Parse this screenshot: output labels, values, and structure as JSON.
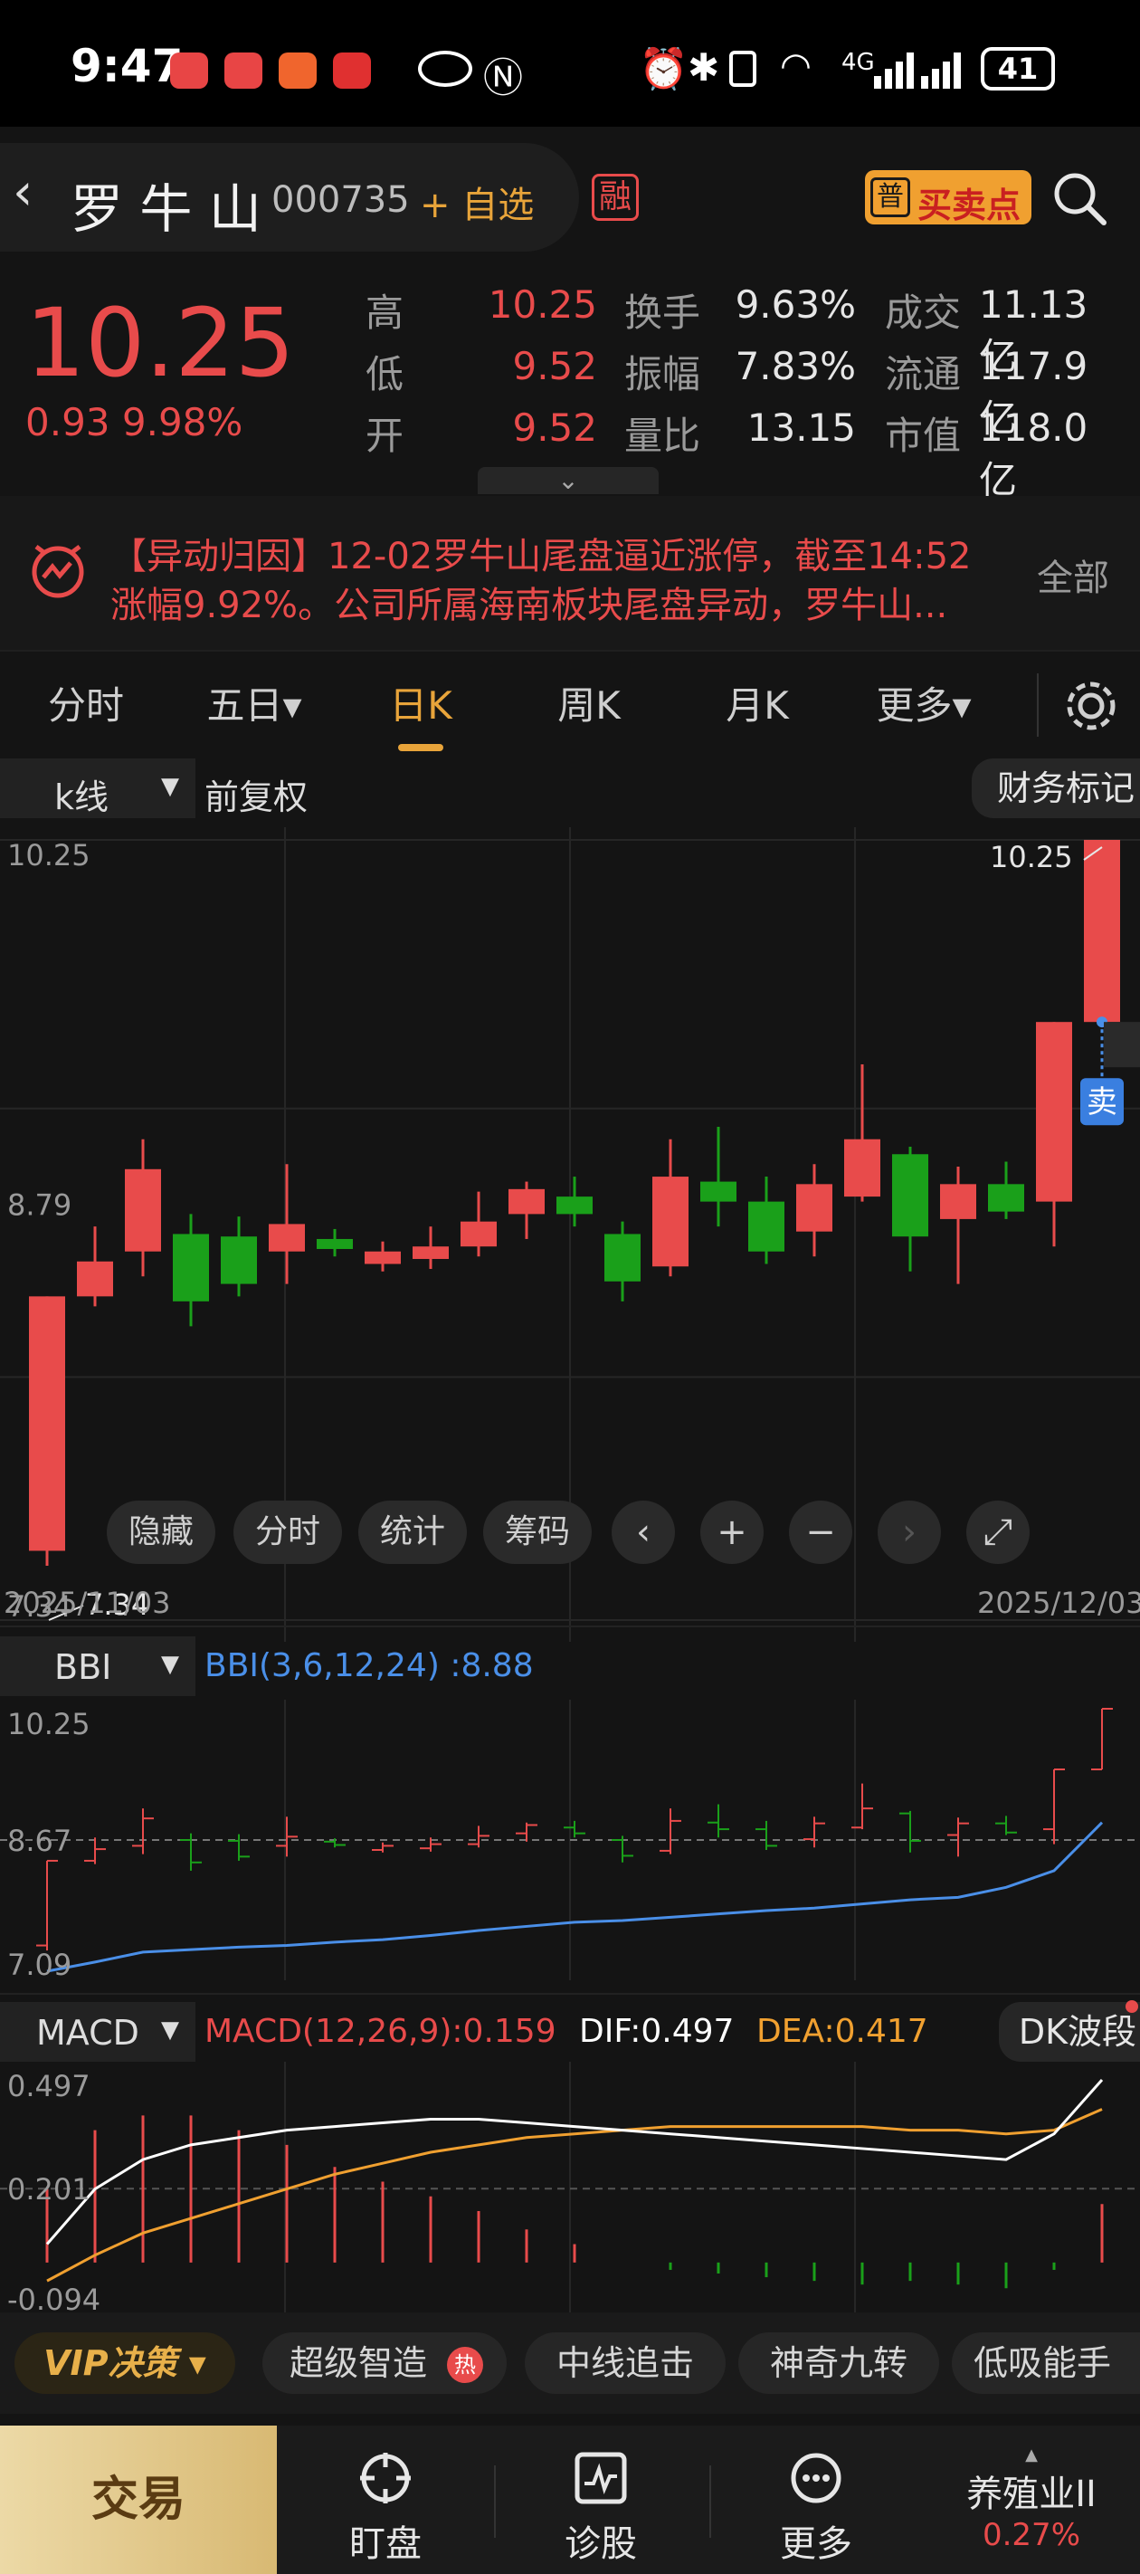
{
  "status_bar": {
    "time": "9:47",
    "battery": "41",
    "network": "4G",
    "app_badges": [
      "huawei-app-icon",
      "red-app-icon",
      "orange-app-icon",
      "red-app-icon-2"
    ]
  },
  "header": {
    "stock_name": "罗 牛 山",
    "stock_code": "000735",
    "add_watch": "+ 自选",
    "margin_tag": "融",
    "buy_sell_label": "买卖点",
    "buy_sell_badge": "普"
  },
  "quote": {
    "price": "10.25",
    "change": "0.93 9.98%",
    "rows": [
      {
        "l1": "高",
        "v1": "10.25",
        "l2": "换手",
        "v2": "9.63%",
        "l3": "成交",
        "v3": "11.13亿"
      },
      {
        "l1": "低",
        "v1": "9.52",
        "l2": "振幅",
        "v2": "7.83%",
        "l3": "流通",
        "v3": "117.9亿"
      },
      {
        "l1": "开",
        "v1": "9.52",
        "l2": "量比",
        "v2": "13.15",
        "l3": "市值",
        "v3": "118.0亿"
      }
    ]
  },
  "news": {
    "text_line1": "【异动归因】12-02罗牛山尾盘逼近涨停，截至14:52",
    "text_line2": "涨幅9.92%。公司所属海南板块尾盘异动，罗牛山...",
    "all_label": "全部"
  },
  "tabs": [
    {
      "label": "分时"
    },
    {
      "label": "五日▾"
    },
    {
      "label": "日K",
      "active": true
    },
    {
      "label": "周K"
    },
    {
      "label": "月K"
    },
    {
      "label": "更多▾"
    }
  ],
  "kline": {
    "type_select": "k线",
    "adjust": "前复权",
    "finance_mark": "财务标记",
    "y_labels": [
      "10.25",
      "8.79",
      "7.34"
    ],
    "high_label": "10.25",
    "low_label": "7.34",
    "start_date": "2025/11/03",
    "end_date": "2025/12/03",
    "sell_tag": "卖",
    "tools": [
      "隐藏",
      "分时",
      "统计",
      "筹码"
    ]
  },
  "bbi": {
    "select": "BBI",
    "title": "BBI(3,6,12,24)",
    "value": ":8.88",
    "y_labels": [
      "10.25",
      "8.67",
      "7.09"
    ]
  },
  "macd": {
    "select": "MACD",
    "title": "MACD(12,26,9):0.159",
    "dif": "DIF:0.497",
    "dea": "DEA:0.417",
    "dk": "DK波段",
    "y_labels": [
      "0.497",
      "0.201",
      "-0.094"
    ]
  },
  "strategy": {
    "vip": "VIP决策",
    "items": [
      "超级智造",
      "中线追击",
      "神奇九转",
      "低吸能手"
    ],
    "hot_badge": "热"
  },
  "bottom_nav": {
    "trade": "交易",
    "items": [
      "盯盘",
      "诊股",
      "更多"
    ],
    "sector_name": "养殖业II",
    "sector_change": "0.27%"
  },
  "colors": {
    "up": "#e84b4b",
    "down": "#1aa01a",
    "bbi_line": "#4a8fe8",
    "dif_line": "#ffffff",
    "dea_line": "#f0a030",
    "accent": "#e8a43a"
  },
  "chart_data": {
    "type": "candlestick",
    "x_start": "2025/11/03",
    "x_end": "2025/12/03",
    "ylim": [
      7.34,
      10.25
    ],
    "candles": [
      {
        "o": 7.4,
        "c": 8.42,
        "h": 8.42,
        "l": 7.34
      },
      {
        "o": 8.42,
        "c": 8.56,
        "h": 8.7,
        "l": 8.38
      },
      {
        "o": 8.6,
        "c": 8.93,
        "h": 9.05,
        "l": 8.5
      },
      {
        "o": 8.67,
        "c": 8.4,
        "h": 8.75,
        "l": 8.3
      },
      {
        "o": 8.66,
        "c": 8.47,
        "h": 8.74,
        "l": 8.42
      },
      {
        "o": 8.6,
        "c": 8.71,
        "h": 8.95,
        "l": 8.47
      },
      {
        "o": 8.65,
        "c": 8.61,
        "h": 8.69,
        "l": 8.58
      },
      {
        "o": 8.55,
        "c": 8.6,
        "h": 8.64,
        "l": 8.52
      },
      {
        "o": 8.57,
        "c": 8.62,
        "h": 8.7,
        "l": 8.53
      },
      {
        "o": 8.62,
        "c": 8.72,
        "h": 8.84,
        "l": 8.58
      },
      {
        "o": 8.75,
        "c": 8.85,
        "h": 8.88,
        "l": 8.65
      },
      {
        "o": 8.82,
        "c": 8.75,
        "h": 8.9,
        "l": 8.7
      },
      {
        "o": 8.67,
        "c": 8.48,
        "h": 8.72,
        "l": 8.4
      },
      {
        "o": 8.54,
        "c": 8.9,
        "h": 9.05,
        "l": 8.5
      },
      {
        "o": 8.88,
        "c": 8.8,
        "h": 9.1,
        "l": 8.7
      },
      {
        "o": 8.8,
        "c": 8.6,
        "h": 8.9,
        "l": 8.55
      },
      {
        "o": 8.68,
        "c": 8.87,
        "h": 8.95,
        "l": 8.58
      },
      {
        "o": 8.82,
        "c": 9.05,
        "h": 9.35,
        "l": 8.8
      },
      {
        "o": 8.99,
        "c": 8.66,
        "h": 9.02,
        "l": 8.52
      },
      {
        "o": 8.73,
        "c": 8.87,
        "h": 8.94,
        "l": 8.47
      },
      {
        "o": 8.87,
        "c": 8.76,
        "h": 8.96,
        "l": 8.73
      },
      {
        "o": 8.8,
        "c": 9.52,
        "h": 9.52,
        "l": 8.62
      },
      {
        "o": 9.52,
        "c": 10.25,
        "h": 10.25,
        "l": 9.52
      }
    ],
    "bbi_values": [
      7.09,
      7.2,
      7.32,
      7.35,
      7.38,
      7.4,
      7.44,
      7.47,
      7.52,
      7.58,
      7.63,
      7.68,
      7.7,
      7.74,
      7.78,
      7.82,
      7.85,
      7.9,
      7.95,
      7.98,
      8.1,
      8.3,
      8.88
    ],
    "macd": {
      "dif": [
        0.05,
        0.2,
        0.28,
        0.32,
        0.34,
        0.36,
        0.37,
        0.38,
        0.39,
        0.39,
        0.38,
        0.37,
        0.36,
        0.35,
        0.34,
        0.33,
        0.32,
        0.31,
        0.3,
        0.29,
        0.28,
        0.35,
        0.497
      ],
      "dea": [
        -0.05,
        0.02,
        0.08,
        0.12,
        0.16,
        0.2,
        0.24,
        0.27,
        0.3,
        0.32,
        0.34,
        0.35,
        0.36,
        0.37,
        0.37,
        0.37,
        0.37,
        0.37,
        0.36,
        0.36,
        0.35,
        0.36,
        0.417
      ],
      "hist": [
        0.2,
        0.36,
        0.4,
        0.4,
        0.36,
        0.32,
        0.26,
        0.22,
        0.18,
        0.14,
        0.09,
        0.05,
        0.0,
        -0.02,
        -0.03,
        -0.04,
        -0.05,
        -0.06,
        -0.05,
        -0.06,
        -0.07,
        -0.02,
        0.159
      ]
    }
  }
}
